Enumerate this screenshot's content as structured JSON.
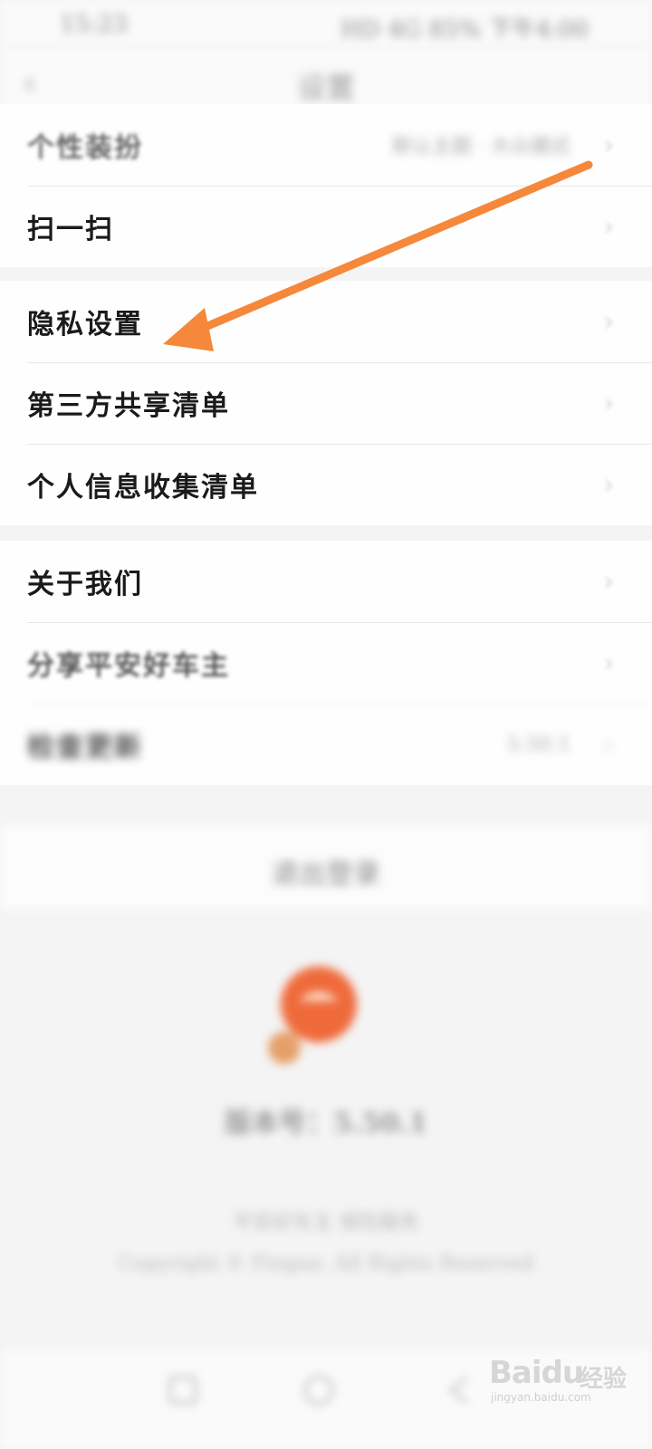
{
  "status_bar": {
    "time": "15:23",
    "right": "HD 4G 85% 下午4:00"
  },
  "nav": {
    "back": "‹",
    "title": "设置"
  },
  "settings": {
    "group1": [
      {
        "label": "个性装扮",
        "value": "默认主题 · 大众模式",
        "blurred": true
      },
      {
        "label": "扫一扫",
        "value": "",
        "blurred": false
      }
    ],
    "group2": [
      {
        "label": "隐私设置"
      },
      {
        "label": "第三方共享清单"
      },
      {
        "label": "个人信息收集清单"
      }
    ],
    "group3": [
      {
        "label": "关于我们",
        "value": ""
      },
      {
        "label": "分享平安好车主",
        "value": ""
      },
      {
        "label": "检查更新",
        "value": "5.50.1"
      }
    ]
  },
  "logout": {
    "label": "退出登录"
  },
  "footer": {
    "version": "版本号：5.50.1",
    "note": "平安好车主 保险服务",
    "copyright": "Copyright © Pingan. All Rights Reserved"
  },
  "watermark": {
    "brand": "Baidu",
    "cn": "经验",
    "url": "jingyan.baidu.com"
  },
  "colors": {
    "accent": "#f5883a",
    "logo": "#ef6a3a"
  },
  "icons": {
    "chevron": "›"
  }
}
